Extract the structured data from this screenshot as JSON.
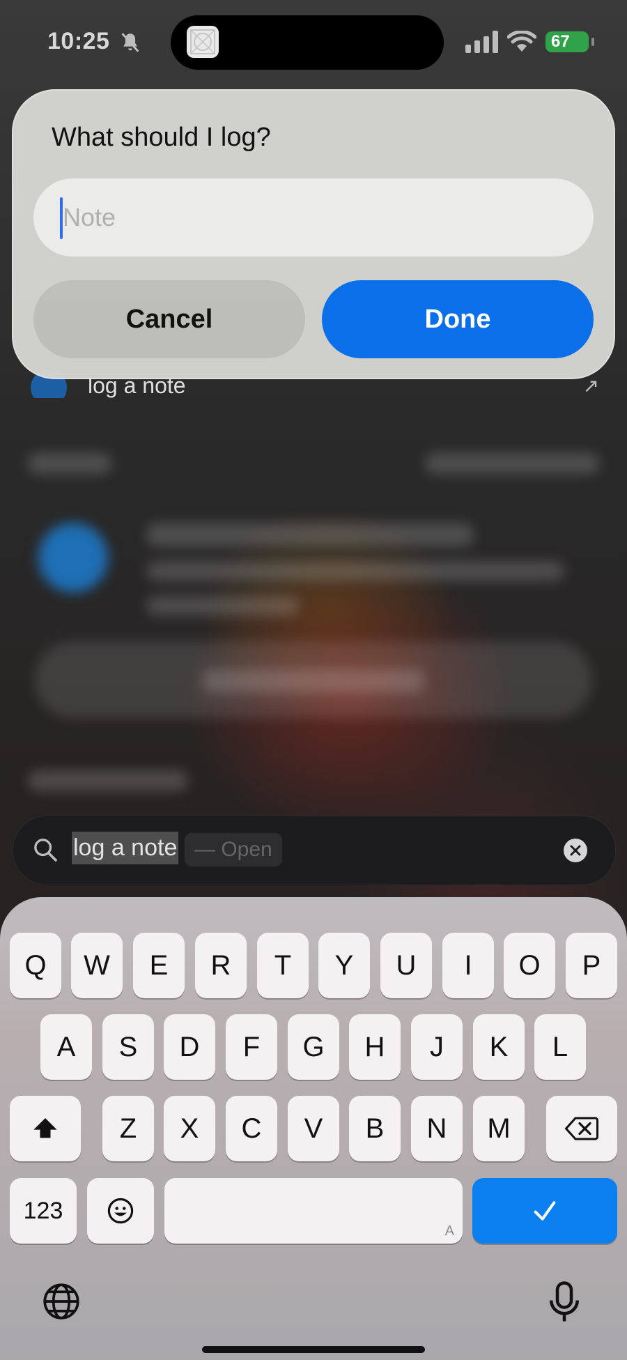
{
  "status_bar": {
    "time": "10:25",
    "battery": "67",
    "icons": [
      "bell-slash-icon",
      "cellular-signal-icon",
      "wifi-icon",
      "battery-charging-icon"
    ]
  },
  "alert": {
    "title": "What should I log?",
    "note_placeholder": "Note",
    "note_value": "",
    "cancel_label": "Cancel",
    "done_label": "Done",
    "accent_color": "#0a6fe8"
  },
  "background_result": {
    "label": "log a note"
  },
  "search": {
    "query": "log a note",
    "suggestion_hint": "— Open"
  },
  "keyboard": {
    "row1": [
      "Q",
      "W",
      "E",
      "R",
      "T",
      "Y",
      "U",
      "I",
      "O",
      "P"
    ],
    "row2": [
      "A",
      "S",
      "D",
      "F",
      "G",
      "H",
      "J",
      "K",
      "L"
    ],
    "row3": [
      "Z",
      "X",
      "C",
      "V",
      "B",
      "N",
      "M"
    ],
    "numbers_label": "123",
    "space_hint": "A",
    "return_color": "#0a7ff0"
  }
}
